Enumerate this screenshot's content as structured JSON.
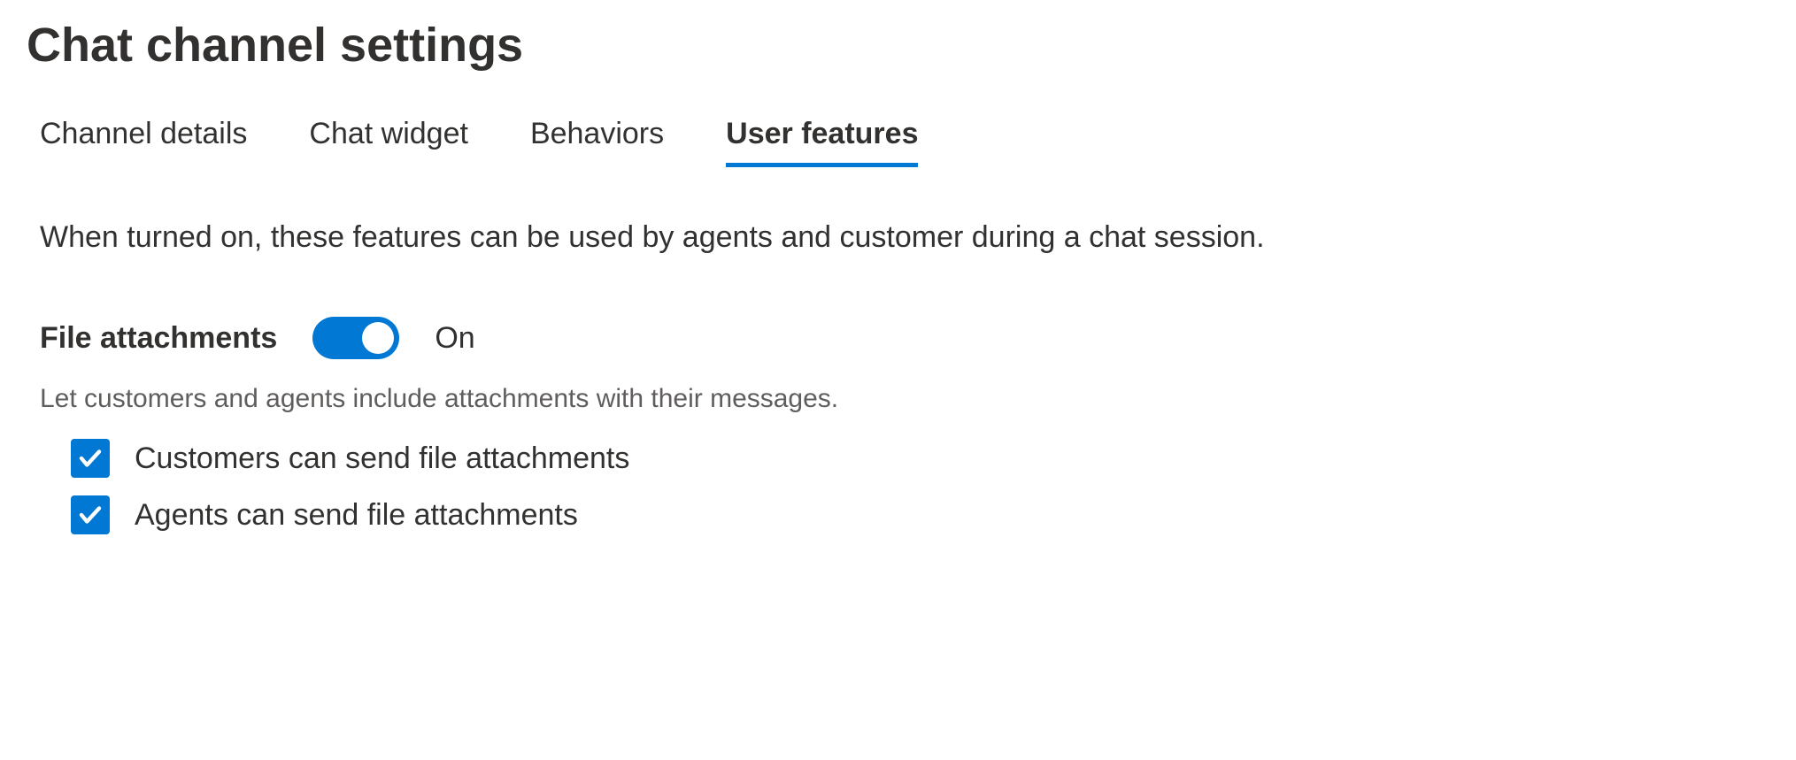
{
  "header": {
    "title": "Chat channel settings"
  },
  "tabs": [
    {
      "label": "Channel details",
      "active": false
    },
    {
      "label": "Chat widget",
      "active": false
    },
    {
      "label": "Behaviors",
      "active": false
    },
    {
      "label": "User features",
      "active": true
    }
  ],
  "content": {
    "description": "When turned on, these features can be used by agents and customer during a chat session.",
    "feature": {
      "label": "File attachments",
      "toggle_state": "On",
      "hint": "Let customers and agents include attachments with their messages.",
      "options": [
        {
          "label": "Customers can send file attachments",
          "checked": true
        },
        {
          "label": "Agents can send file attachments",
          "checked": true
        }
      ]
    }
  }
}
